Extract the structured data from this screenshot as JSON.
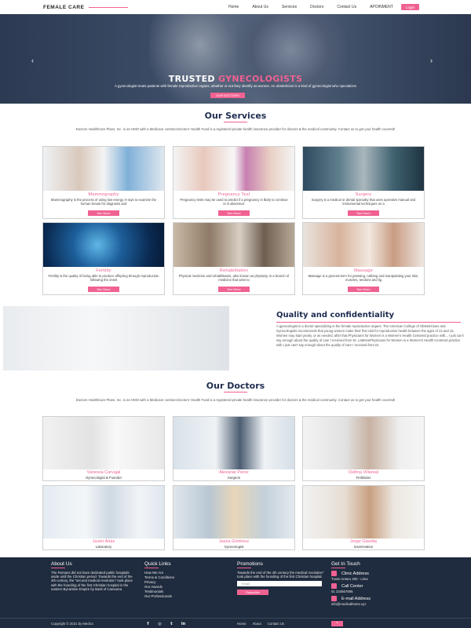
{
  "brand": "FEMALE CARE",
  "nav": {
    "links": [
      "Home",
      "About Us",
      "Services",
      "Doctors",
      "Contact Us",
      "APOINMENT"
    ],
    "login": "Login"
  },
  "hero": {
    "title_white": "TRUSTED",
    "title_pink": "GYNECOLOGISTS",
    "subtitle": "A gynecologist treats patients with female reproductive organs, whether or not they identify as women. An obstetrician is a kind of gynecologist who specializes",
    "button": "OUR DOCTORS",
    "prev": "‹",
    "next": "›"
  },
  "services": {
    "title": "Our Services",
    "description": "Doctors HealthCare Plans, Inc. is an HMO with a Medicare contract.Doctors' Health Fund is a registered private health insurance provider for doctors & the medical community. Contact us to get your health covered!",
    "cards": [
      {
        "title": "Mammography",
        "desc": "Mammography is the process of using low-energy X-rays to examine the human breast for diagnosis and",
        "button": "See More"
      },
      {
        "title": "Pregnancy Test",
        "desc": "Pregnancy tests may be used to predict if a pregnancy is likely to continue or is abnormal.",
        "button": "See More"
      },
      {
        "title": "Surgery",
        "desc": "Surgery is a medical or dental specialty that uses operative manual and instrumental techniques on a",
        "button": "See More"
      },
      {
        "title": "Fertility",
        "desc": "Fertility is the quality of being able to produce offspring through reproduction following the onset",
        "button": "See More"
      },
      {
        "title": "Rehabilitation",
        "desc": "Physical medicine and rehabilitation, also known as physiatry, is a branch of medicine that aims to",
        "button": "See More"
      },
      {
        "title": "Massage",
        "desc": "Massage is a general term for pressing, rubbing and manipulating your skin, muscles, tendons and lig",
        "button": "See More"
      }
    ]
  },
  "quality": {
    "title": "Quality and confidentiality",
    "text": "A gynecologist is a doctor specializing in the female reproductive organs. The American College of Obstetricians and Gynecologists recommends that young women make their first visit for reproductive health between the ages of 13 and 15. Women may start yearly, or as needed, after that.Physicians for Women is a Women's Health Centered practice with... I just can't say enough about the quality of care I received from Dr. LaMonePhysicians for Women is a Women's Health Centered practice with.I just can't say enough about the quality of care I received from Dr."
  },
  "doctors": {
    "title": "Our Doctors",
    "description": "Doctors HealthCare Plans, Inc. is an HMO with a Medicare contract.Doctors' Health Fund is a registered private health insurance provider for doctors & the medical community. Contact us to get your health covered!",
    "list": [
      {
        "name": "Vanessa Carvajal",
        "role": "Gynecologist & Founder"
      },
      {
        "name": "Alexanar Perez",
        "role": "Surgeon"
      },
      {
        "name": "Dellma Villareal",
        "role": "Fertilation"
      },
      {
        "name": "Javier Arias",
        "role": "Laboratory"
      },
      {
        "name": "Jasna Giménez",
        "role": "Gynecologist"
      },
      {
        "name": "Jorge Gavidia",
        "role": "Insemination"
      }
    ]
  },
  "footer": {
    "about_title": "About Us",
    "about_text": "The Romans did not have dedicated public hospitals aside until the Christian period. Towards the end of the 4th century, the \"second medical revolution\" took place with the founding of the first Christian hospital in the eastern Byzantine Empire by Basil of Caesarea.",
    "quick_title": "Quick Links",
    "quick_links": [
      "How We Are",
      "Terms & Conditions",
      "Privacy",
      "Our Awards",
      "Testimonials",
      "Our Professionals"
    ],
    "promo_title": "Promotions",
    "promo_text": "Towards the end of the 4th century the medical revolution\" took place with the founding of the first Christian hospital.",
    "email_placeholder": "Email",
    "subscribe": "Subscribe",
    "touch_title": "Get In Touch",
    "clinic_label": "Clinic Address",
    "clinic_value": "Tussn Amaru 200 - Lima",
    "call_label": "Call Center",
    "call_value": "01 234567895",
    "email_label": "E-mail Address",
    "email_value": "info@medicalhome.xyz",
    "copyright": "Copyright © 2021 by Medicc",
    "social": [
      "f",
      "◎",
      "t",
      "in"
    ],
    "bottom_links": [
      "Home",
      "About",
      "Contact Us"
    ],
    "top_button": "^"
  },
  "colors": {
    "accent": "#f06292",
    "navy": "#1d2b4f",
    "footer": "#1f2b3e"
  }
}
